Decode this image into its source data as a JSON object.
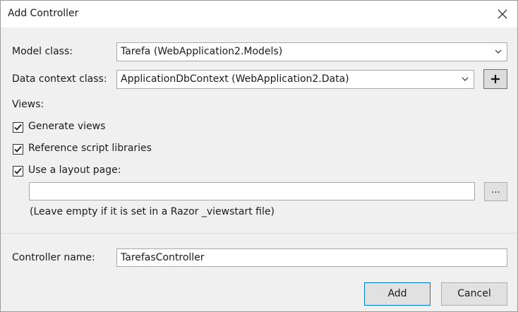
{
  "window": {
    "title": "Add Controller",
    "close_icon": "close-icon"
  },
  "model_class": {
    "label": "Model class:",
    "value": "Tarefa (WebApplication2.Models)"
  },
  "data_context_class": {
    "label": "Data context class:",
    "value": "ApplicationDbContext (WebApplication2.Data)",
    "add_icon": "plus-icon"
  },
  "views": {
    "label": "Views:",
    "generate_views": {
      "label": "Generate views",
      "checked": true
    },
    "reference_scripts": {
      "label": "Reference script libraries",
      "checked": true
    },
    "use_layout": {
      "label": "Use a layout page:",
      "checked": true
    },
    "layout_path": {
      "value": ""
    },
    "browse_label": "...",
    "hint": "(Leave empty if it is set in a Razor _viewstart file)"
  },
  "controller_name": {
    "label": "Controller name:",
    "value": "TarefasController"
  },
  "buttons": {
    "add": "Add",
    "cancel": "Cancel"
  },
  "colors": {
    "body_bg": "#f0f0f0",
    "accent_border": "#0078d7",
    "button_bg": "#e1e1e1"
  }
}
